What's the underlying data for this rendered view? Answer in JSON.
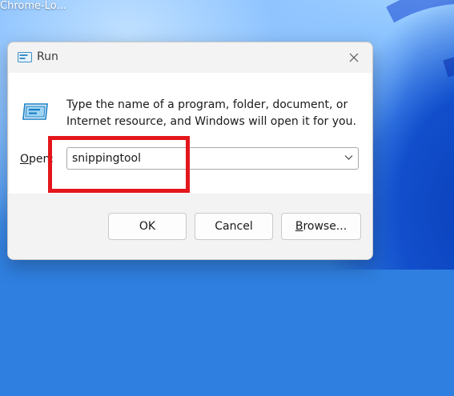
{
  "desktop": {
    "shortcut_label": "Chrome-Lo..."
  },
  "dialog": {
    "title": "Run",
    "description": "Type the name of a program, folder, document, or Internet resource, and Windows will open it for you.",
    "open_label_accel": "O",
    "open_label_rest": "pen:",
    "open_value": "snippingtool",
    "buttons": {
      "ok": "OK",
      "cancel": "Cancel",
      "browse_accel": "B",
      "browse_rest": "rowse..."
    }
  },
  "colors": {
    "highlight": "#e3161c",
    "dialog_background": "#f3f3f3",
    "content_background": "#ffffff"
  },
  "icons": {
    "title": "run-icon",
    "close": "close-icon",
    "dropdown": "chevron-down-icon"
  }
}
